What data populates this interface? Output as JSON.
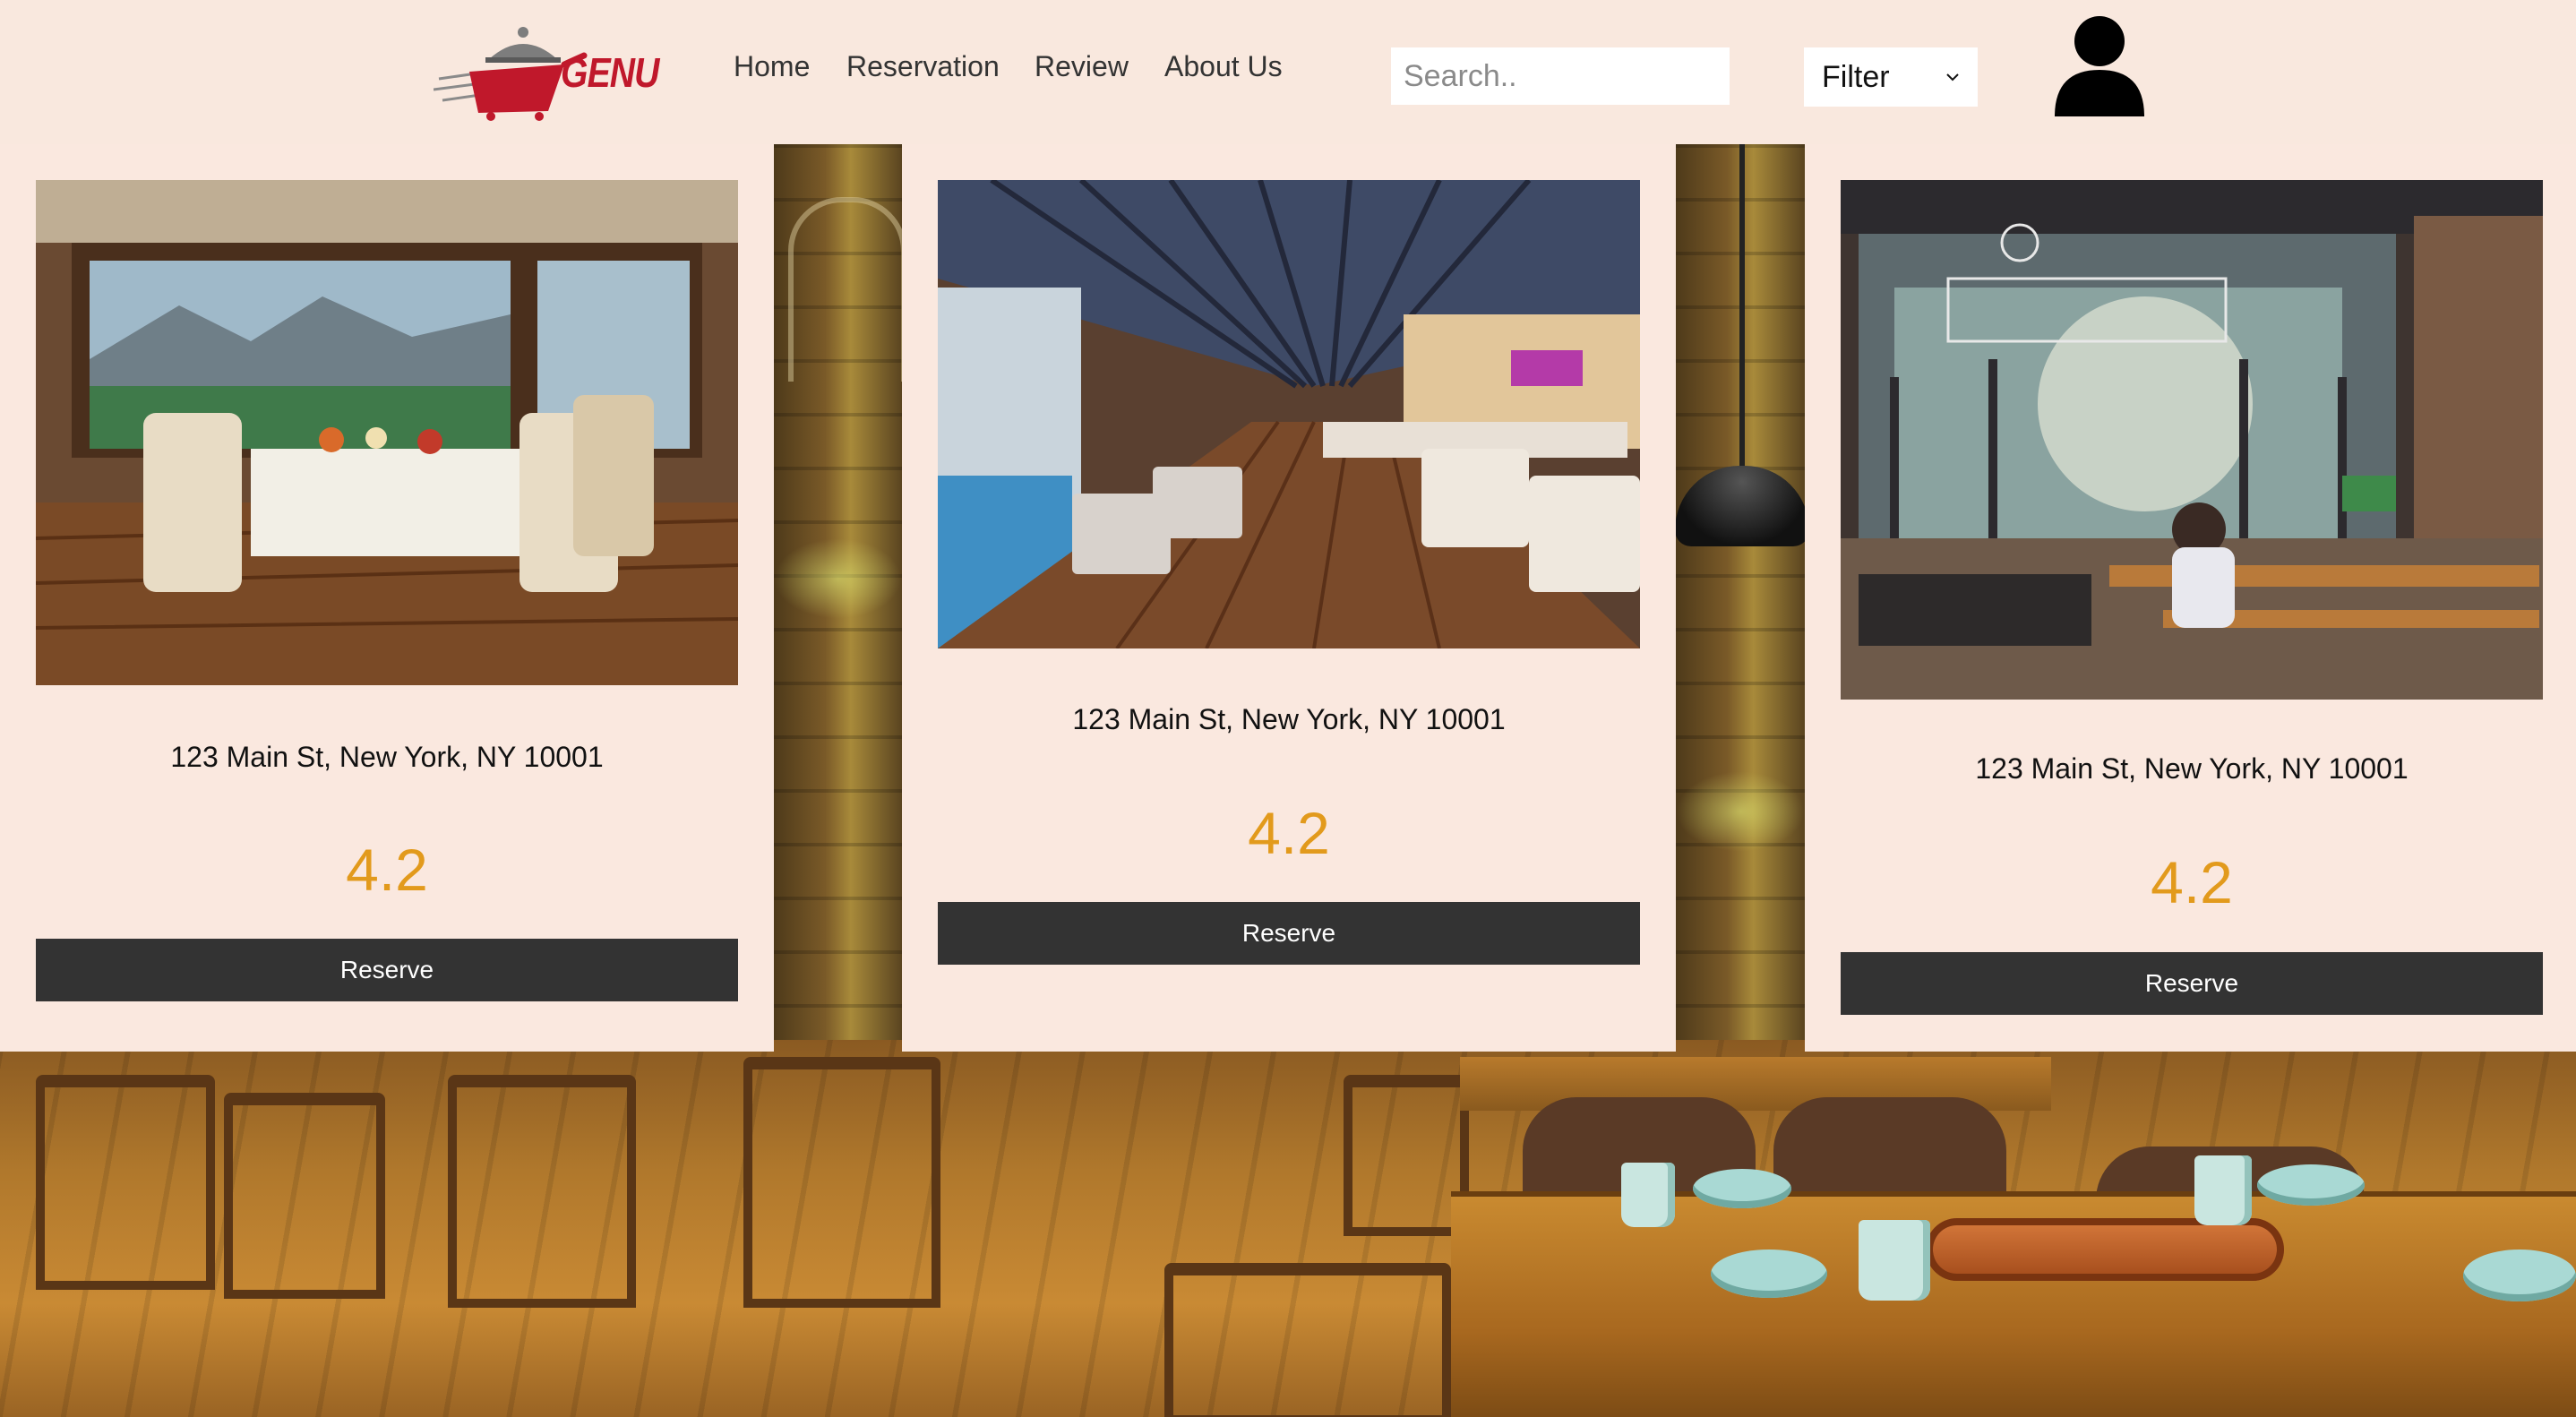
{
  "brand": {
    "name": "GENU",
    "accent": "#c0182b"
  },
  "nav": {
    "items": [
      {
        "label": "Home"
      },
      {
        "label": "Reservation"
      },
      {
        "label": "Review"
      },
      {
        "label": "About Us"
      }
    ]
  },
  "search": {
    "placeholder": "Search..",
    "value": "",
    "icon": "none"
  },
  "filter": {
    "selected": "Filter",
    "icon": "chevron-down-icon"
  },
  "user": {
    "icon": "user-silhouette-icon"
  },
  "colors": {
    "header_bg": "#f9e8de",
    "card_bg": "#fae8df",
    "rating": "#e29a1c",
    "button_bg": "#333333",
    "button_text": "#ffffff"
  },
  "cards": [
    {
      "address": "123 Main St, New York, NY 10001",
      "rating": "4.2",
      "button_label": "Reserve",
      "image": "dining-room-with-window-view"
    },
    {
      "address": "123 Main St, New York, NY 10001",
      "rating": "4.2",
      "button_label": "Reserve",
      "image": "poolside-restaurant-interior"
    },
    {
      "address": "123 Main St, New York, NY 10001",
      "rating": "4.2",
      "button_label": "Reserve",
      "image": "artichoke-coffee-shop"
    }
  ]
}
